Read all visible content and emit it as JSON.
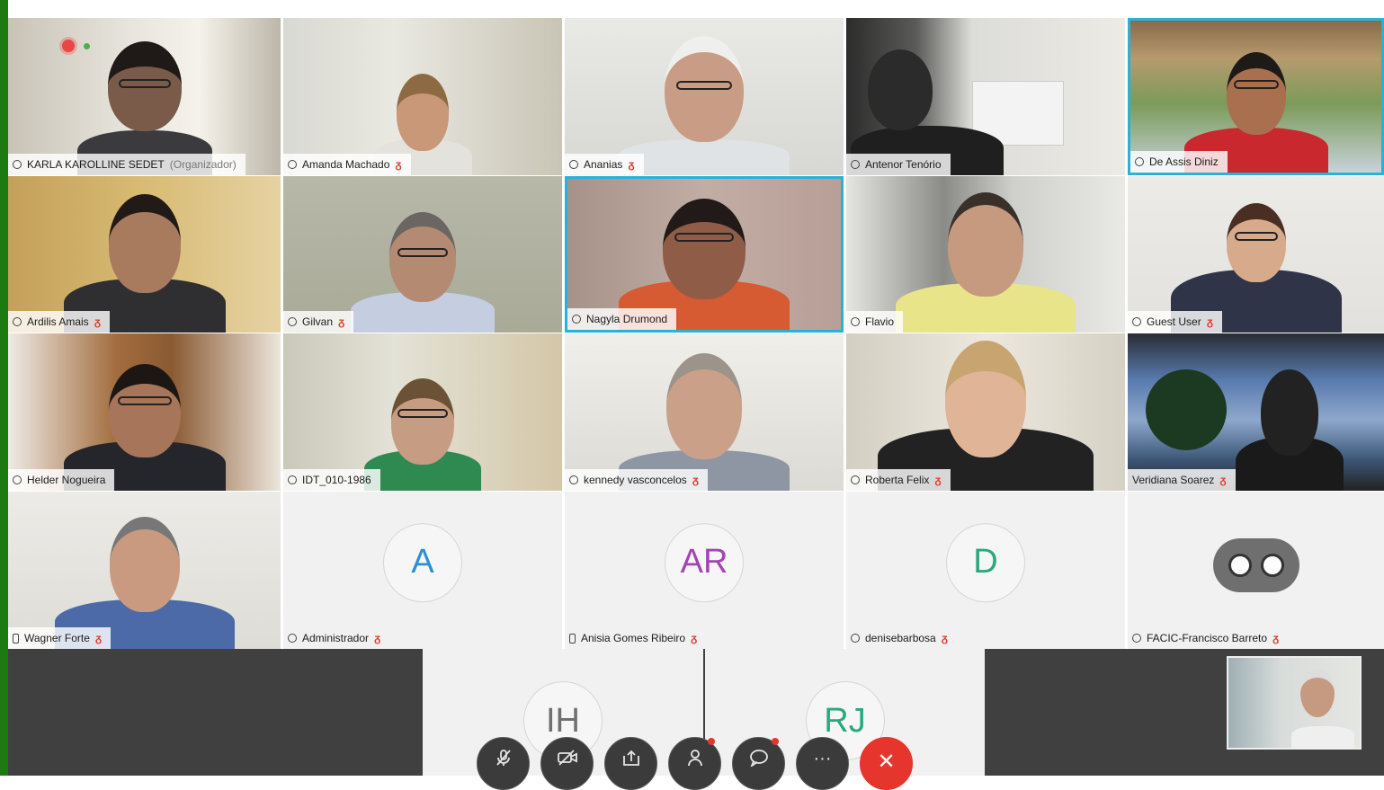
{
  "participants": [
    {
      "name": "KARLA KAROLLINE SEDET",
      "role": "(Organizador)",
      "muted": false
    },
    {
      "name": "Amanda Machado",
      "muted": true
    },
    {
      "name": "Ananias",
      "muted": true
    },
    {
      "name": "Antenor Tenório",
      "muted": false
    },
    {
      "name": "De Assis Diniz",
      "muted": false
    },
    {
      "name": "Ardilis Amais",
      "muted": true
    },
    {
      "name": "Gilvan",
      "muted": true
    },
    {
      "name": "Nagyla Drumond",
      "muted": false
    },
    {
      "name": "Flavio",
      "muted": false
    },
    {
      "name": "Guest User",
      "muted": true
    },
    {
      "name": "Helder Nogueira",
      "muted": false
    },
    {
      "name": "IDT_010-1986",
      "muted": false
    },
    {
      "name": "kennedy vasconcelos",
      "muted": true
    },
    {
      "name": "Roberta Felix",
      "muted": true
    },
    {
      "name": "Veridiana Soarez",
      "muted": true
    },
    {
      "name": "Wagner Forte",
      "muted": true
    },
    {
      "name": "Administrador",
      "initials": "A",
      "initials_color": "#2f8fd0",
      "muted": true
    },
    {
      "name": "Anisia Gomes Ribeiro",
      "initials": "AR",
      "initials_color": "#a245b3",
      "muted": true
    },
    {
      "name": "denisebarbosa",
      "initials": "D",
      "initials_color": "#2aa87f",
      "muted": true
    },
    {
      "name": "FACIC-Francisco Barreto",
      "muted": true
    }
  ],
  "bottom_row": [
    {
      "initials": "IH",
      "initials_color": "#707070"
    },
    {
      "initials": "RJ",
      "initials_color": "#2aa87f"
    }
  ],
  "toolbar": {
    "mute": "mic-off-icon",
    "video": "video-off-icon",
    "share": "share-icon",
    "participants": "participants-icon",
    "chat": "chat-icon",
    "more": "more-icon",
    "end": "end-call-icon",
    "more_label": "···",
    "end_label": "✕"
  },
  "mute_glyph": "ᵹ",
  "colors": {
    "active_speaker": "#27b3d6",
    "end_call": "#e6352c",
    "brand_bar": "#1d7a12"
  }
}
